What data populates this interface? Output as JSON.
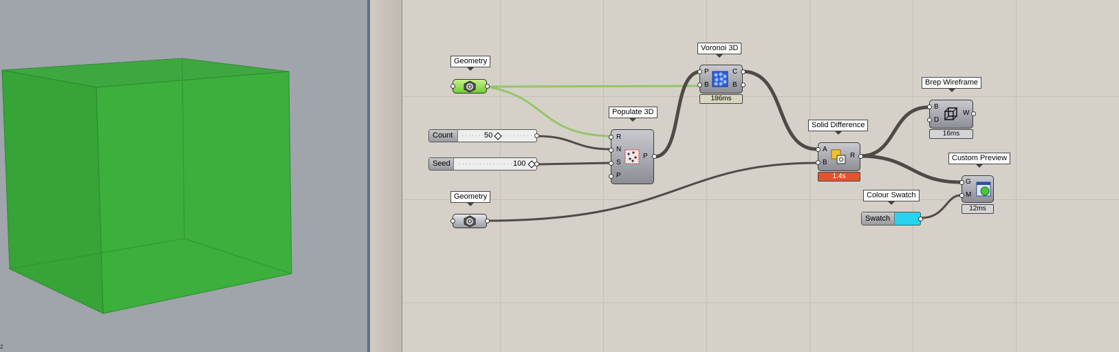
{
  "viewport": {
    "corner_mark": "z",
    "cube_color": "#39a83a"
  },
  "canvas": {
    "labels": {
      "geometry1": "Geometry",
      "voronoi": "Voronoi 3D",
      "populate": "Populate 3D",
      "solid_difference": "Solid Difference",
      "brep_wireframe": "Brep Wireframe",
      "custom_preview": "Custom Preview",
      "colour_swatch": "Colour Swatch",
      "geometry2": "Geometry"
    },
    "sliders": [
      {
        "name": "Count",
        "value": "50"
      },
      {
        "name": "Seed",
        "value": "100"
      }
    ],
    "populate_inputs": [
      "R",
      "N",
      "S",
      "P"
    ],
    "populate_output": "P",
    "voronoi": {
      "inputs": [
        "P",
        "B"
      ],
      "outputs": [
        "C",
        "B"
      ],
      "timer": "186ms"
    },
    "solid_difference": {
      "inputs": [
        "A",
        "B"
      ],
      "output": "R",
      "timer": "1.4s"
    },
    "brep_wireframe": {
      "inputs": [
        "B",
        "D"
      ],
      "output": "W",
      "timer": "16ms"
    },
    "custom_preview": {
      "inputs": [
        "G",
        "M"
      ],
      "timer": "12ms"
    },
    "swatch": {
      "name": "Swatch",
      "color": "#27d3ee"
    },
    "colors": {
      "error_timer": "#e0552b",
      "wire": "#4f4a45",
      "wire_selected": "#95c46a"
    }
  }
}
